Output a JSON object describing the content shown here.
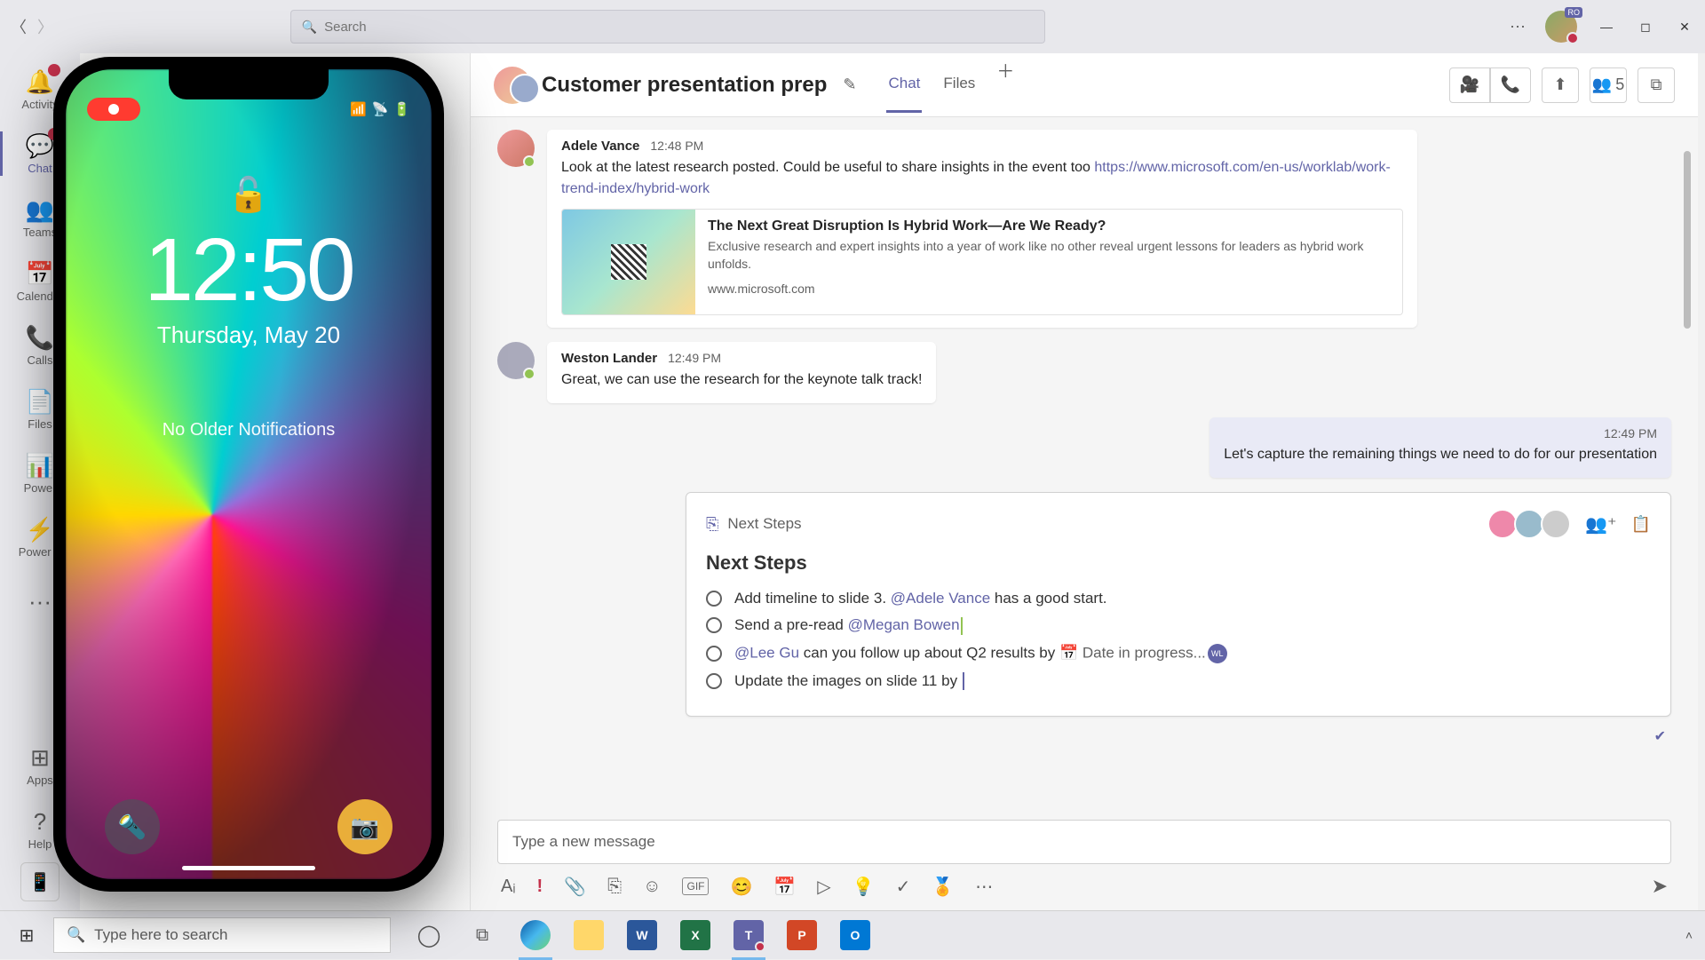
{
  "titlebar": {
    "search_placeholder": "Search",
    "avatar_initials": "RO"
  },
  "rail": {
    "items": [
      {
        "label": "Activity",
        "icon": "🔔",
        "badge": ""
      },
      {
        "label": "Chat",
        "icon": "💬",
        "badge": "●",
        "active": true
      },
      {
        "label": "Teams",
        "icon": "👥"
      },
      {
        "label": "Calendar",
        "icon": "📅"
      },
      {
        "label": "Calls",
        "icon": "📞"
      },
      {
        "label": "Files",
        "icon": "📄"
      },
      {
        "label": "Power",
        "icon": "📊"
      },
      {
        "label": "Power A",
        "icon": "⚡"
      }
    ],
    "more": "···",
    "apps": "Apps",
    "help": "Help"
  },
  "chat_header": {
    "title": "Customer presentation prep",
    "tabs": [
      "Chat",
      "Files"
    ],
    "active_tab": "Chat",
    "participants_count": "5"
  },
  "messages": [
    {
      "author": "Adele Vance",
      "time": "12:48 PM",
      "text_before_link": "Look at the latest research posted. Could be useful to share insights in the event too ",
      "link": "https://www.microsoft.com/en-us/worklab/work-trend-index/hybrid-work",
      "card": {
        "title": "The Next Great Disruption Is Hybrid Work—Are We Ready?",
        "desc": "Exclusive research and expert insights into a year of work like no other reveal urgent lessons for leaders as hybrid work unfolds.",
        "domain": "www.microsoft.com"
      }
    },
    {
      "author": "Weston Lander",
      "time": "12:49 PM",
      "text": "Great, we can use the research for the keynote talk track!"
    },
    {
      "self": true,
      "time": "12:49 PM",
      "text": "Let's capture the remaining things we need to do for our presentation"
    }
  ],
  "loop": {
    "tab_name": "Next Steps",
    "title": "Next Steps",
    "tasks": [
      {
        "pre": "Add timeline to slide 3. ",
        "mention": "@Adele Vance",
        "post": " has a good start."
      },
      {
        "pre": "Send a pre-read ",
        "mention": "@Megan Bowen",
        "caret": true
      },
      {
        "pre": "",
        "mention": "@Lee Gu",
        "post": " can you follow up about Q2 results by ",
        "date": "📅 Date in progress...",
        "chip": "WL"
      },
      {
        "pre": "Update the images on slide 11 by ",
        "caret": true
      }
    ]
  },
  "compose": {
    "placeholder": "Type a new message"
  },
  "phone": {
    "time": "12:50",
    "date": "Thursday, May 20",
    "notif": "No Older Notifications",
    "status": "••l 📶 🔋"
  },
  "taskbar": {
    "search_placeholder": "Type here to search",
    "apps": [
      {
        "name": "cortana",
        "color": "transparent",
        "glyph": "◯"
      },
      {
        "name": "taskview",
        "color": "transparent",
        "glyph": "⧉"
      },
      {
        "name": "edge",
        "color": "#47b8ee",
        "glyph": "e",
        "active": true
      },
      {
        "name": "explorer",
        "color": "#ffd76a",
        "glyph": "📁"
      },
      {
        "name": "word",
        "color": "#2b579a",
        "glyph": "W"
      },
      {
        "name": "excel",
        "color": "#217346",
        "glyph": "X"
      },
      {
        "name": "teams",
        "color": "#6264a7",
        "glyph": "T",
        "active": true,
        "badge": "●"
      },
      {
        "name": "powerpoint",
        "color": "#d24726",
        "glyph": "P"
      },
      {
        "name": "outlook",
        "color": "#0078d4",
        "glyph": "O"
      }
    ]
  }
}
